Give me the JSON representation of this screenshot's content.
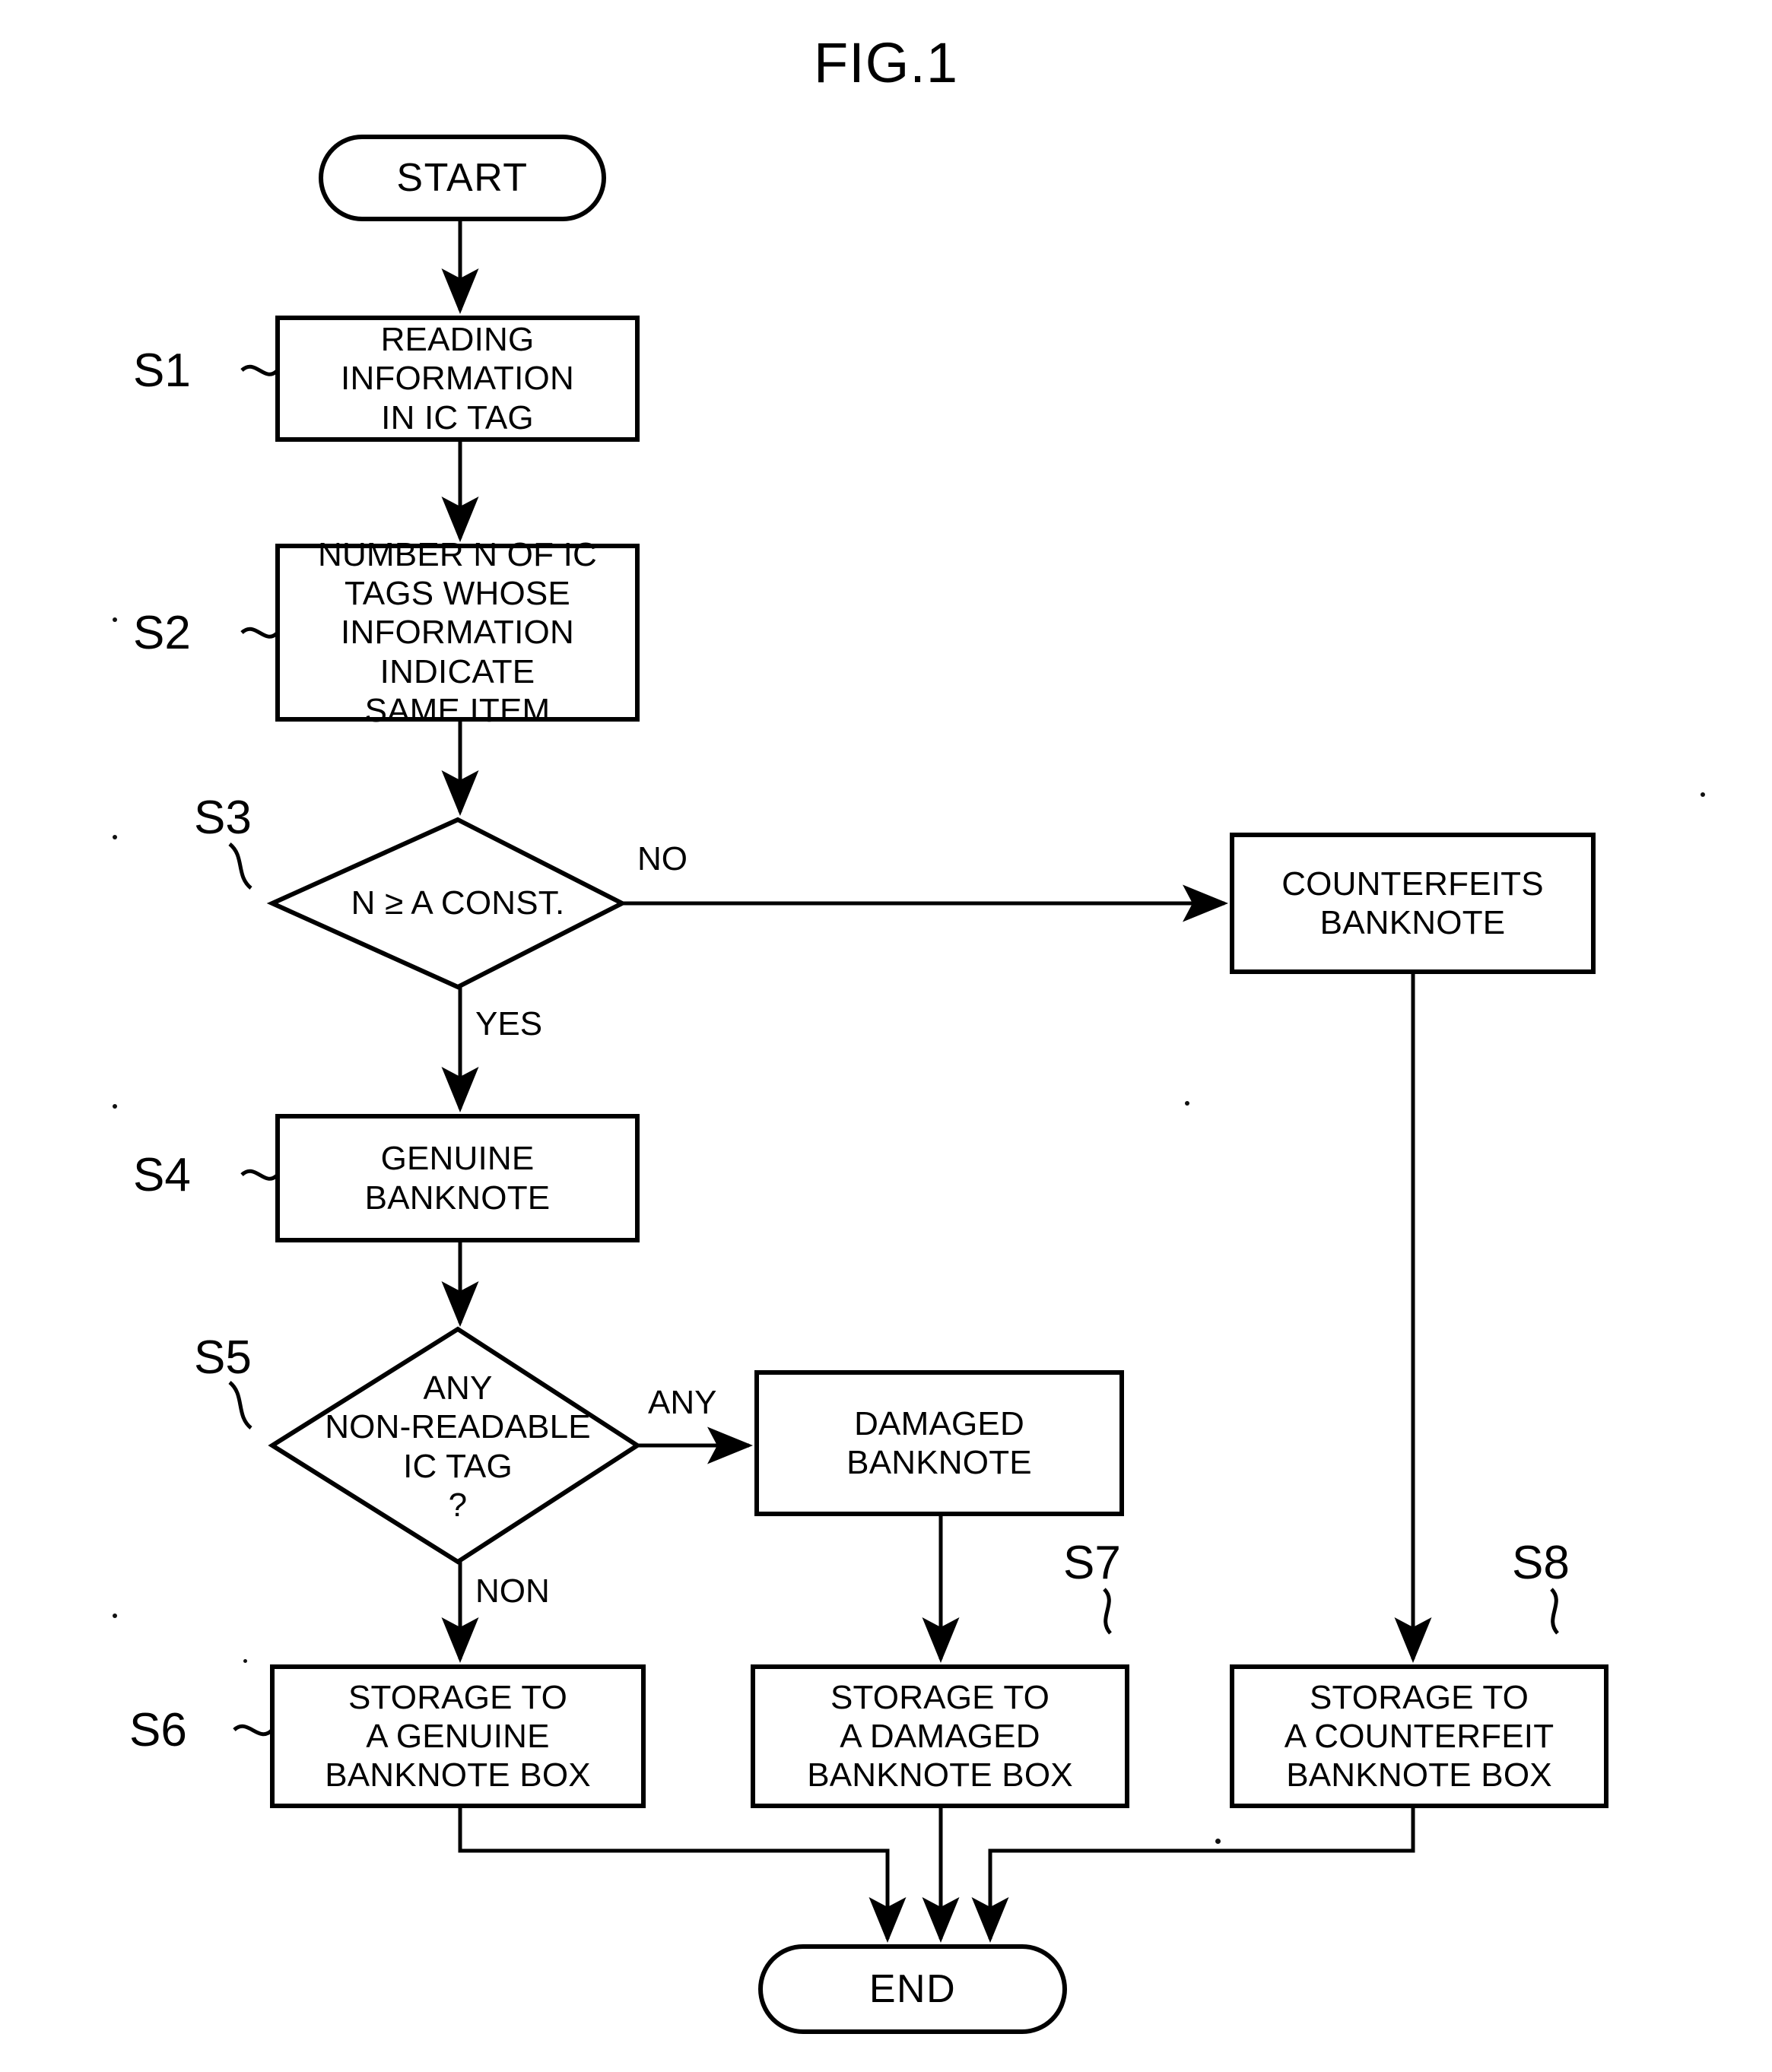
{
  "figure": {
    "title": "FIG.1"
  },
  "flowchart": {
    "type": "flowchart",
    "orientation": "top-to-bottom",
    "nodes": [
      {
        "id": "start",
        "shape": "terminator",
        "text": "START",
        "step": null
      },
      {
        "id": "s1",
        "shape": "process",
        "step": "S1",
        "lines": [
          "READING",
          "INFORMATION",
          "IN IC TAG"
        ]
      },
      {
        "id": "s2",
        "shape": "process",
        "step": "S2",
        "lines": [
          "NUMBER N OF IC",
          "TAGS WHOSE",
          "INFORMATION",
          "INDICATE",
          "SAME ITEM"
        ]
      },
      {
        "id": "s3",
        "shape": "decision",
        "step": "S3",
        "lines": [
          "N ≥ A CONST."
        ]
      },
      {
        "id": "counterfeits",
        "shape": "process",
        "step": null,
        "lines": [
          "COUNTERFEITS",
          "BANKNOTE"
        ]
      },
      {
        "id": "s4",
        "shape": "process",
        "step": "S4",
        "lines": [
          "GENUINE",
          "BANKNOTE"
        ]
      },
      {
        "id": "s5",
        "shape": "decision",
        "step": "S5",
        "lines": [
          "ANY",
          "NON-READABLE",
          "IC TAG",
          "?"
        ]
      },
      {
        "id": "damaged",
        "shape": "process",
        "step": null,
        "lines": [
          "DAMAGED",
          "BANKNOTE"
        ]
      },
      {
        "id": "s6",
        "shape": "process",
        "step": "S6",
        "lines": [
          "STORAGE TO",
          "A GENUINE",
          "BANKNOTE BOX"
        ]
      },
      {
        "id": "s7",
        "shape": "process",
        "step": "S7",
        "lines": [
          "STORAGE TO",
          "A DAMAGED",
          "BANKNOTE BOX"
        ]
      },
      {
        "id": "s8",
        "shape": "process",
        "step": "S8",
        "lines": [
          "STORAGE TO",
          "A COUNTERFEIT",
          "BANKNOTE BOX"
        ]
      },
      {
        "id": "end",
        "shape": "terminator",
        "text": "END",
        "step": null
      }
    ],
    "edges": [
      {
        "from": "start",
        "to": "s1",
        "label": ""
      },
      {
        "from": "s1",
        "to": "s2",
        "label": ""
      },
      {
        "from": "s2",
        "to": "s3",
        "label": ""
      },
      {
        "from": "s3",
        "to": "counterfeits",
        "label": "NO"
      },
      {
        "from": "s3",
        "to": "s4",
        "label": "YES"
      },
      {
        "from": "s4",
        "to": "s5",
        "label": ""
      },
      {
        "from": "s5",
        "to": "damaged",
        "label": "ANY"
      },
      {
        "from": "s5",
        "to": "s6",
        "label": "NON"
      },
      {
        "from": "damaged",
        "to": "s7",
        "label": ""
      },
      {
        "from": "counterfeits",
        "to": "s8",
        "label": ""
      },
      {
        "from": "s6",
        "to": "end",
        "label": ""
      },
      {
        "from": "s7",
        "to": "end",
        "label": ""
      },
      {
        "from": "s8",
        "to": "end",
        "label": ""
      }
    ]
  },
  "text": {
    "start": "START",
    "end": "END",
    "s1_l1": "READING",
    "s1_l2": "INFORMATION",
    "s1_l3": "IN IC TAG",
    "s2_l1": "NUMBER N OF IC",
    "s2_l2": "TAGS WHOSE",
    "s2_l3": "INFORMATION",
    "s2_l4": "INDICATE",
    "s2_l5": "SAME ITEM",
    "s3_l1": "N ≥ A CONST.",
    "counterfeits_l1": "COUNTERFEITS",
    "counterfeits_l2": "BANKNOTE",
    "s4_l1": "GENUINE",
    "s4_l2": "BANKNOTE",
    "s5_l1": "ANY",
    "s5_l2": "NON-READABLE",
    "s5_l3": "IC TAG",
    "s5_l4": "?",
    "damaged_l1": "DAMAGED",
    "damaged_l2": "BANKNOTE",
    "s6_l1": "STORAGE TO",
    "s6_l2": "A GENUINE",
    "s6_l3": "BANKNOTE BOX",
    "s7_l1": "STORAGE TO",
    "s7_l2": "A DAMAGED",
    "s7_l3": "BANKNOTE BOX",
    "s8_l1": "STORAGE TO",
    "s8_l2": "A COUNTERFEIT",
    "s8_l3": "BANKNOTE BOX"
  },
  "steps": {
    "s1": "S1",
    "s2": "S2",
    "s3": "S3",
    "s4": "S4",
    "s5": "S5",
    "s6": "S6",
    "s7": "S7",
    "s8": "S8"
  },
  "branch_labels": {
    "no": "NO",
    "yes": "YES",
    "any": "ANY",
    "non": "NON"
  },
  "style": {
    "line_color": "#000000",
    "background": "#ffffff",
    "stroke_width": 5
  }
}
